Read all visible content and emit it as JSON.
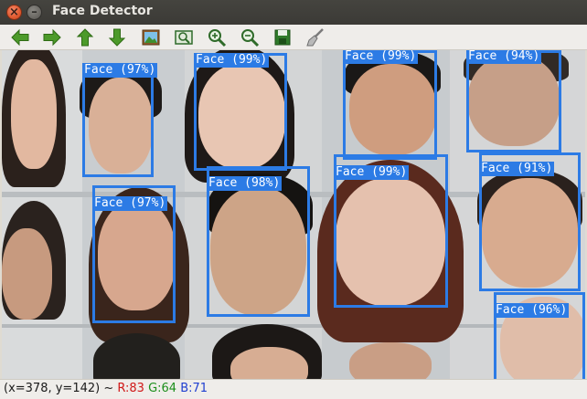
{
  "window": {
    "title": "Face Detector"
  },
  "toolbar": {
    "buttons": [
      {
        "icon": "arrow-left-icon"
      },
      {
        "icon": "arrow-right-icon"
      },
      {
        "icon": "arrow-up-icon"
      },
      {
        "icon": "arrow-down-icon"
      },
      {
        "icon": "image-icon"
      },
      {
        "icon": "zoom-fit-icon"
      },
      {
        "icon": "zoom-in-icon"
      },
      {
        "icon": "zoom-out-icon"
      },
      {
        "icon": "save-icon"
      },
      {
        "icon": "clear-brush-icon"
      }
    ]
  },
  "detections": [
    {
      "label": "Face (97%)"
    },
    {
      "label": "Face (99%)"
    },
    {
      "label": "Face (99%)"
    },
    {
      "label": "Face (94%)"
    },
    {
      "label": "Face (97%)"
    },
    {
      "label": "Face (98%)"
    },
    {
      "label": "Face (99%)"
    },
    {
      "label": "Face (91%)"
    },
    {
      "label": "Face (96%)"
    }
  ],
  "status": {
    "coords": "(x=378, y=142) ~",
    "r": "R:83",
    "g": "G:64",
    "b": "B:71"
  },
  "colors": {
    "box": "#2c7be5",
    "title_bar": "#3c3b37",
    "status_r": "#d01818",
    "status_g": "#1c8f1c",
    "status_b": "#1f3fd0"
  }
}
